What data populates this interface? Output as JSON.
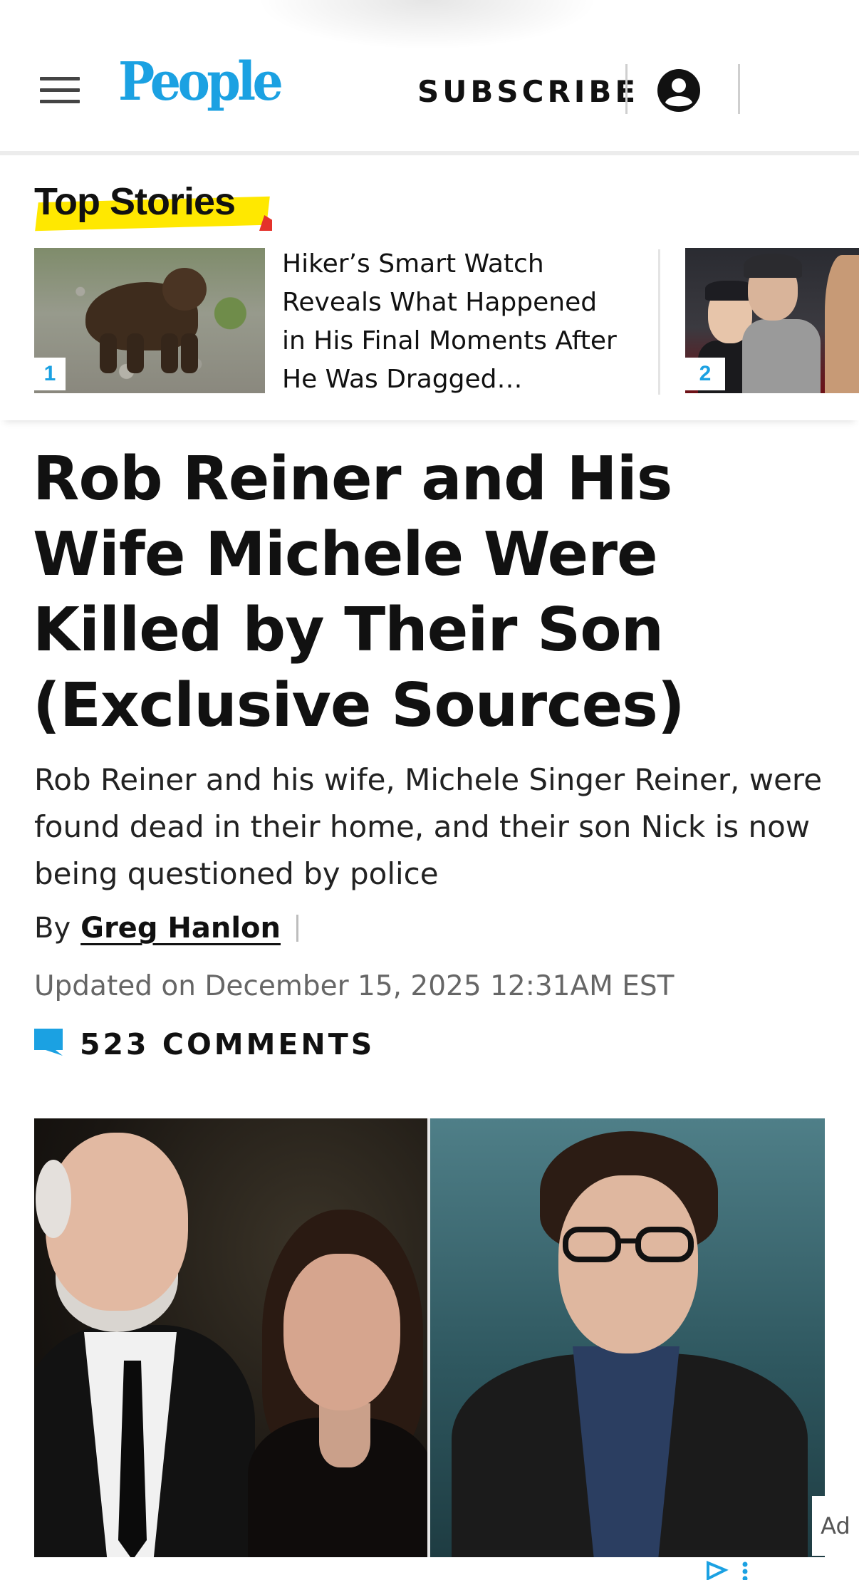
{
  "header": {
    "logo_text": "People",
    "subscribe_label": "SUBSCRIBE",
    "brand_color": "#1ba1e2"
  },
  "top_stories": {
    "heading": "Top Stories",
    "items": [
      {
        "number": "1",
        "title": "Hiker’s Smart Watch Reveals What Happened in His Final Moments After He Was Dragged…"
      },
      {
        "number": "2",
        "title": ""
      }
    ]
  },
  "article": {
    "headline": "Rob Reiner and His Wife Michele Were Killed by Their Son (Exclusive Sources)",
    "dek": "Rob Reiner and his wife, Michele Singer Reiner, were found dead in their home, and their son Nick is now being questioned by police",
    "by_prefix": "By",
    "author": "Greg Hanlon",
    "updated": "Updated on December 15, 2025 12:31AM EST",
    "comments_label": "523  COMMENTS",
    "comment_icon_color": "#1ba1e2"
  },
  "ad": {
    "label": "Ad"
  }
}
